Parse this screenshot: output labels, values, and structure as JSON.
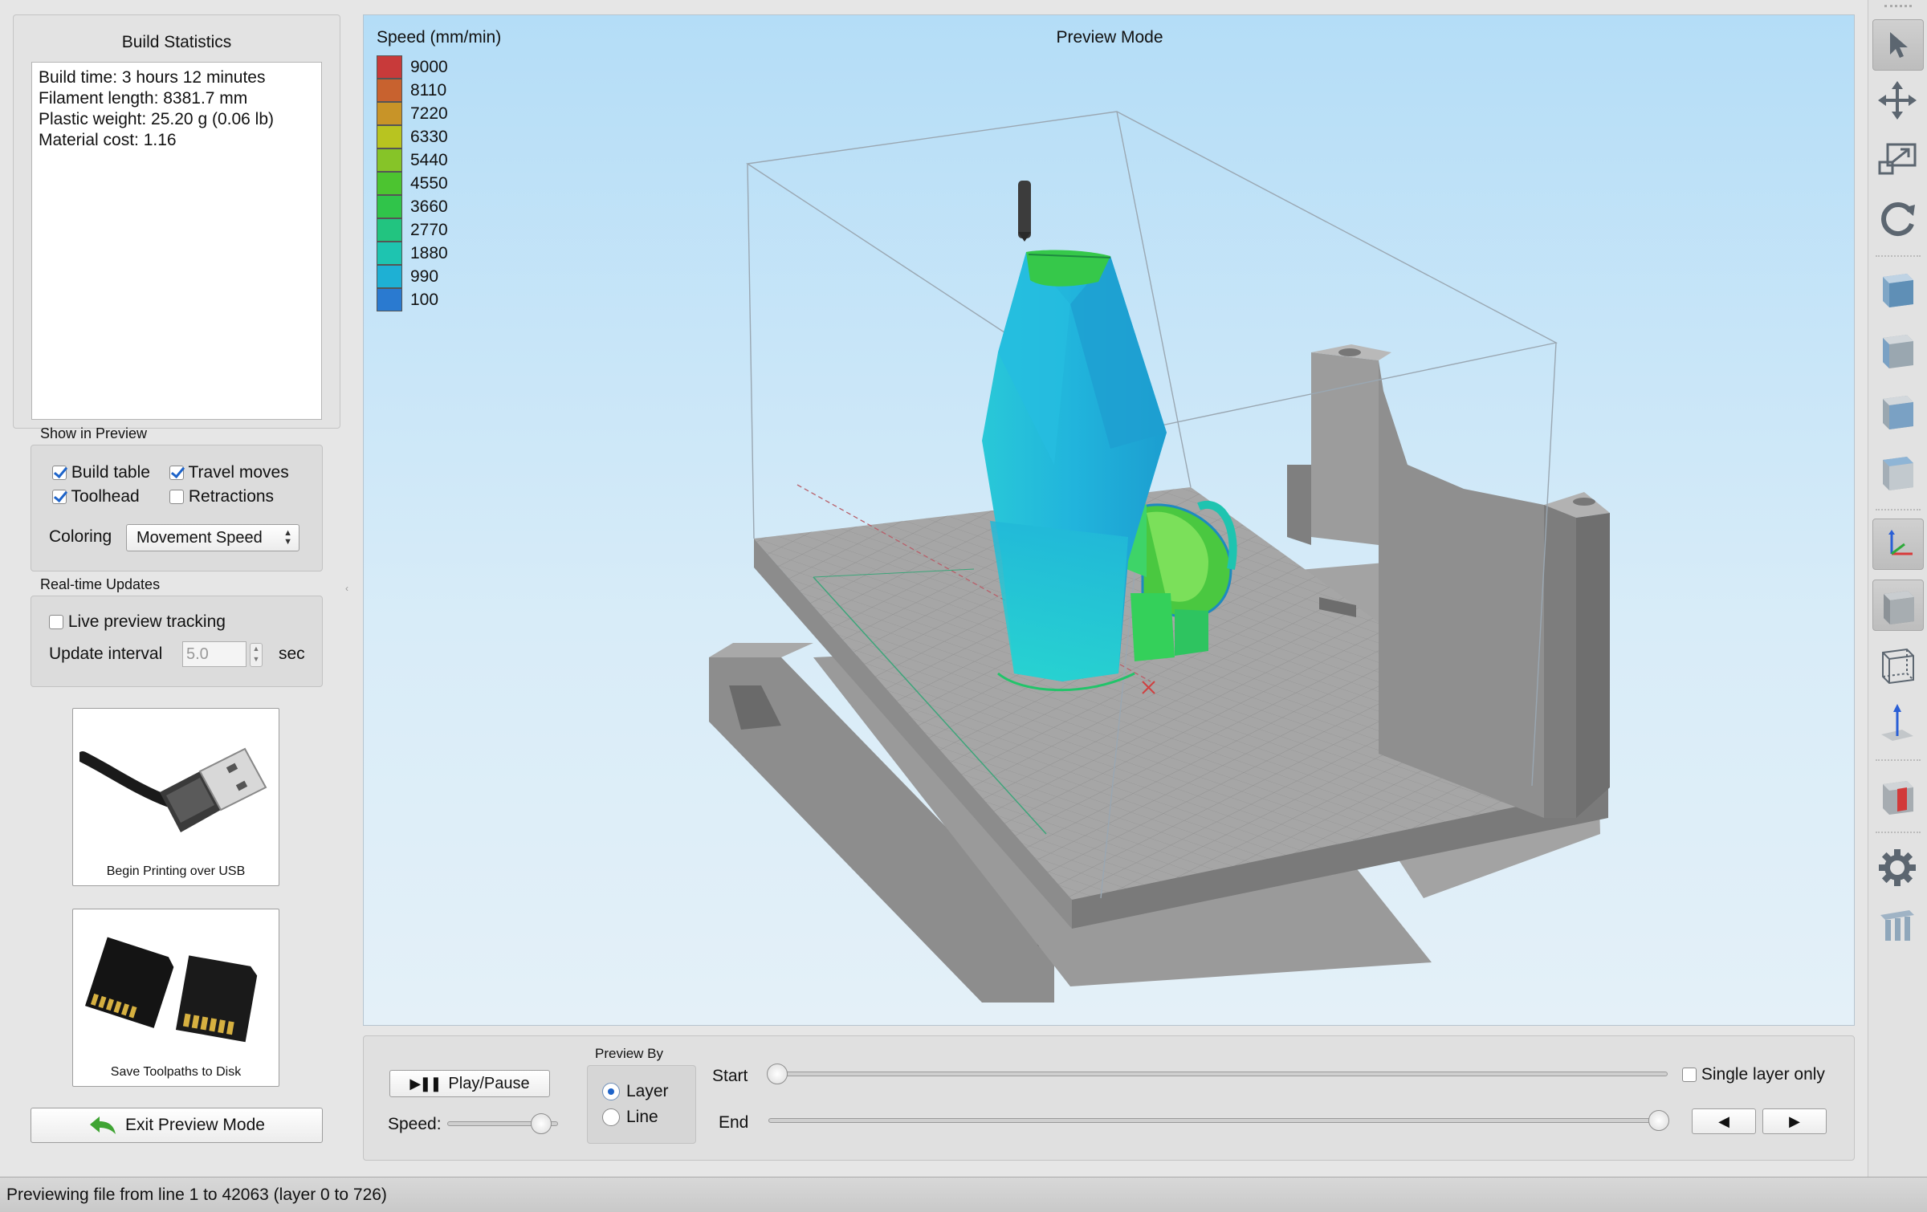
{
  "build_statistics": {
    "title": "Build Statistics",
    "lines": [
      "Build time: 3 hours 12 minutes",
      "Filament length: 8381.7 mm",
      "Plastic weight: 25.20 g (0.06 lb)",
      "Material cost: 1.16"
    ]
  },
  "show_in_preview": {
    "title": "Show in Preview",
    "build_table": {
      "label": "Build table",
      "checked": true
    },
    "travel_moves": {
      "label": "Travel moves",
      "checked": true
    },
    "toolhead": {
      "label": "Toolhead",
      "checked": true
    },
    "retractions": {
      "label": "Retractions",
      "checked": false
    },
    "coloring_label": "Coloring",
    "coloring_value": "Movement Speed"
  },
  "realtime_updates": {
    "title": "Real-time Updates",
    "live_tracking": {
      "label": "Live preview tracking",
      "checked": false
    },
    "interval_label": "Update interval",
    "interval_value": "5.0",
    "interval_unit": "sec"
  },
  "actions": {
    "usb_label": "Begin Printing over USB",
    "disk_label": "Save Toolpaths to Disk",
    "exit_label": "Exit Preview Mode"
  },
  "viewport": {
    "mode_title": "Preview Mode",
    "legend_title": "Speed (mm/min)",
    "legend": [
      {
        "value": "9000",
        "color": "#c83a3a"
      },
      {
        "value": "8110",
        "color": "#c8622f"
      },
      {
        "value": "7220",
        "color": "#c89428"
      },
      {
        "value": "6330",
        "color": "#b8c420"
      },
      {
        "value": "5440",
        "color": "#86c428"
      },
      {
        "value": "4550",
        "color": "#4cc430"
      },
      {
        "value": "3660",
        "color": "#30c44a"
      },
      {
        "value": "2770",
        "color": "#22c480"
      },
      {
        "value": "1880",
        "color": "#1ec4b0"
      },
      {
        "value": "990",
        "color": "#1eb0d4"
      },
      {
        "value": "100",
        "color": "#2a7ad0"
      }
    ]
  },
  "playback": {
    "play_label": "Play/Pause",
    "speed_label": "Speed:",
    "speed_level": 0.85,
    "preview_by_title": "Preview By",
    "layer_label": "Layer",
    "line_label": "Line",
    "selected": "Layer",
    "start_label": "Start",
    "end_label": "End",
    "single_layer_label": "Single layer only",
    "single_layer_checked": false,
    "start_fraction": 0.0,
    "end_fraction": 1.0
  },
  "status_bar": {
    "text": "Previewing file from line 1 to 42063 (layer 0 to 726)"
  },
  "toolbar_icons": [
    "select-arrow-icon",
    "move-icon",
    "scale-icon",
    "rotate-icon",
    "view-iso-cube-icon",
    "view-front-cube-icon",
    "view-side-cube-icon",
    "view-top-cube-icon",
    "axes-icon",
    "solid-cube-icon",
    "wireframe-cube-icon",
    "z-axis-icon",
    "cross-section-icon",
    "settings-gear-icon",
    "supports-icon"
  ]
}
